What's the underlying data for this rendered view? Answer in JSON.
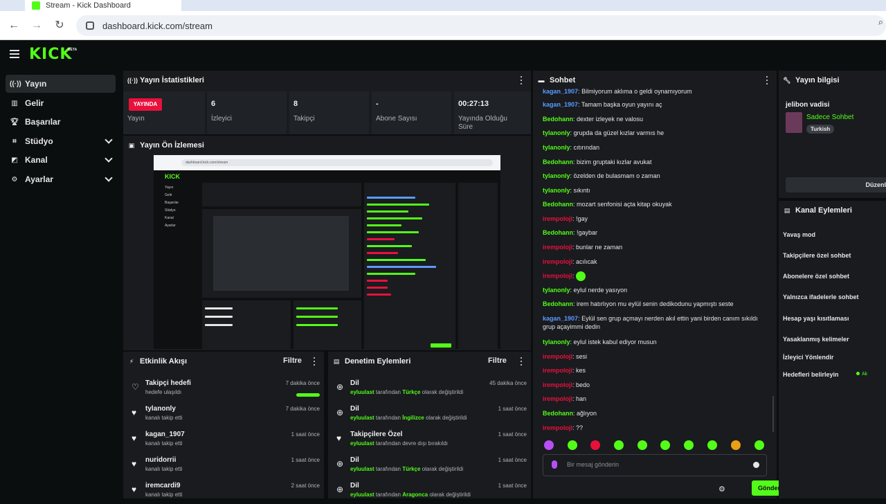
{
  "browser": {
    "tab_title": "Stream - Kick Dashboard",
    "url": "dashboard.kick.com/stream"
  },
  "brand": {
    "logo": "KICK",
    "badge": "BETA",
    "accent": "#53fc18"
  },
  "sidebar": {
    "items": [
      {
        "label": "Yayın",
        "icon": "broadcast-icon",
        "active": true
      },
      {
        "label": "Gelir",
        "icon": "chart-icon"
      },
      {
        "label": "Başarılar",
        "icon": "trophy-icon"
      },
      {
        "label": "Stüdyo",
        "icon": "studio-icon",
        "expandable": true
      },
      {
        "label": "Kanal",
        "icon": "channel-icon",
        "expandable": true
      },
      {
        "label": "Ayarlar",
        "icon": "gear-icon",
        "expandable": true
      }
    ]
  },
  "stats": {
    "title": "Yayın İstatistikleri",
    "live_badge": "YAYINDA",
    "live_label": "Yayın",
    "viewers": {
      "value": "6",
      "label": "İzleyici"
    },
    "followers": {
      "value": "8",
      "label": "Takipçi"
    },
    "subs": {
      "value": "-",
      "label": "Abone Sayısı"
    },
    "uptime": {
      "value": "00:27:13",
      "label": "Yayında Olduğu Süre"
    }
  },
  "preview": {
    "title": "Yayın Ön İzlemesi",
    "url": "dashboard.kick.com/stream",
    "logo": "KICK",
    "side_items": [
      "Yayın",
      "Gelir",
      "Başarılar",
      "Stüdyo",
      "Kanal",
      "Ayarlar"
    ]
  },
  "activity": {
    "title": "Etkinlik Akışı",
    "filter": "Filtre",
    "items": [
      {
        "title": "Takipçi hedefi",
        "sub": "hedefe ulaşıldı",
        "time": "7 dakika önce",
        "progress": 1.0
      },
      {
        "title": "tylanonly",
        "sub": "kanalı takip etti",
        "time": "7 dakika önce"
      },
      {
        "title": "kagan_1907",
        "sub": "kanalı takip etti",
        "time": "1 saat önce"
      },
      {
        "title": "nuridorrii",
        "sub": "kanalı takip etti",
        "time": "1 saat önce"
      },
      {
        "title": "iremcardi9",
        "sub": "kanalı takip etti",
        "time": "2 saat önce"
      }
    ]
  },
  "moderation": {
    "title": "Denetim Eylemleri",
    "filter": "Filtre",
    "by_word": "tarafından",
    "items": [
      {
        "title": "Dil",
        "user": "eyluulast",
        "value": "Türkçe",
        "suffix": "olarak değiştirildi",
        "time": "45 dakika önce"
      },
      {
        "title": "Dil",
        "user": "eyluulast",
        "value": "İngilizce",
        "suffix": "olarak değiştirildi",
        "time": "1 saat önce"
      },
      {
        "title": "Takipçilere Özel",
        "user": "eyluulast",
        "value": "",
        "suffix": "devre dışı bırakıldı",
        "time": "1 saat önce"
      },
      {
        "title": "Dil",
        "user": "eyluulast",
        "value": "Türkçe",
        "suffix": "olarak değiştirildi",
        "time": "1 saat önce"
      },
      {
        "title": "Dil",
        "user": "eyluulast",
        "value": "Aragonca",
        "suffix": "olarak değiştirildi",
        "time": "1 saat önce"
      }
    ]
  },
  "chat": {
    "title": "Sohbet",
    "placeholder": "Bir mesaj gönderin",
    "send": "Gönder",
    "messages": [
      {
        "user": "kagan_1907",
        "color": "#5b9bff",
        "text": "Bilmiyorum aklıma o geldi oynamıyorum"
      },
      {
        "user": "kagan_1907",
        "color": "#5b9bff",
        "text": "Tamam başka oyun yayını aç"
      },
      {
        "user": "Bedohann",
        "color": "#53fc18",
        "text": "dexter izleyek ne valosu"
      },
      {
        "user": "tylanonly",
        "color": "#53fc18",
        "text": "grupda da güzel kızlar varmıs he"
      },
      {
        "user": "tylanonly",
        "color": "#53fc18",
        "text": "cıtırından"
      },
      {
        "user": "Bedohann",
        "color": "#53fc18",
        "text": "bizim gruptaki kızlar avukat"
      },
      {
        "user": "tylanonly",
        "color": "#53fc18",
        "text": "özelden de bulasmam o zaman"
      },
      {
        "user": "tylanonly",
        "color": "#53fc18",
        "text": "sıkıntı"
      },
      {
        "user": "Bedohann",
        "color": "#53fc18",
        "text": "mozart senfonisi açta kitap okuyak"
      },
      {
        "user": "irempoloji",
        "color": "#e9113c",
        "text": "!gay"
      },
      {
        "user": "Bedohann",
        "color": "#53fc18",
        "text": "!gaybar"
      },
      {
        "user": "irempoloji",
        "color": "#e9113c",
        "text": "bunlar ne zaman"
      },
      {
        "user": "irempoloji",
        "color": "#e9113c",
        "text": "acılıcak"
      },
      {
        "user": "irempoloji",
        "color": "#e9113c",
        "text": ""
      },
      {
        "user": "tylanonly",
        "color": "#53fc18",
        "text": "eylul nerde yasıyon"
      },
      {
        "user": "Bedohann",
        "color": "#53fc18",
        "text": "irem hatırlıyon mu eylül senin dedikodunu yapmıştı seste"
      },
      {
        "user": "kagan_1907",
        "color": "#5b9bff",
        "text": "Eylül sen grup açmayı nerden akıl ettin yani birden canım sıkıldı grup açayimmi dedin"
      },
      {
        "user": "tylanonly",
        "color": "#53fc18",
        "text": "eylul istek kabul ediyor musun"
      },
      {
        "user": "irempoloji",
        "color": "#e9113c",
        "text": "sesi"
      },
      {
        "user": "irempoloji",
        "color": "#e9113c",
        "text": "kes"
      },
      {
        "user": "irempoloji",
        "color": "#e9113c",
        "text": "bedo"
      },
      {
        "user": "irempoloji",
        "color": "#e9113c",
        "text": "han"
      },
      {
        "user": "Bedohann",
        "color": "#53fc18",
        "text": "ağlıyon"
      },
      {
        "user": "irempoloji",
        "color": "#e9113c",
        "text": "??"
      }
    ]
  },
  "stream_info": {
    "title": "Yayın bilgisi",
    "stream_title": "jelibon vadisi",
    "category": "Sadece Sohbet",
    "tag": "Turkish",
    "edit": "Düzenle"
  },
  "channel_actions": {
    "title": "Kanal Eylemleri",
    "items": [
      "Yavaş mod",
      "Takipçilere özel sohbet",
      "Abonelere özel sohbet",
      "Yalnızca ifadelerle sohbet",
      "Hesap yaşı kısıtlaması",
      "Yasaklanmış kelimeler",
      "İzleyici Yönlendir",
      "Hedefleri belirleyin"
    ],
    "status": "Ak"
  }
}
